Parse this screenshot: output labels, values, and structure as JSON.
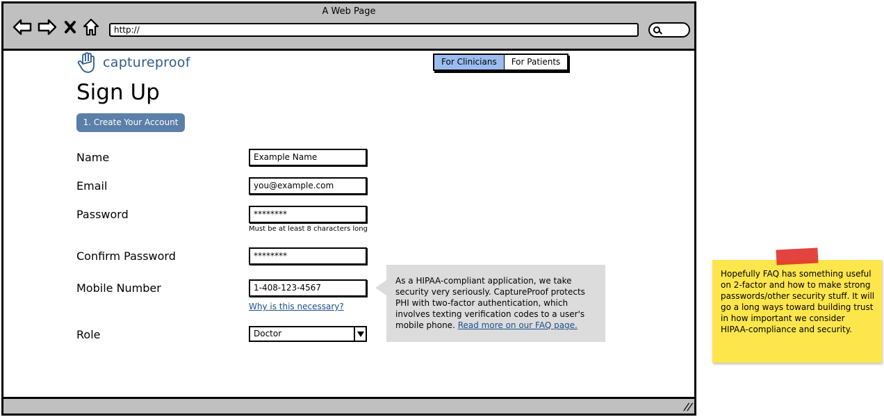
{
  "window": {
    "title": "A Web Page",
    "url": "http://",
    "nav_icons": [
      "back-arrow-icon",
      "forward-arrow-icon",
      "close-x-icon",
      "home-icon"
    ],
    "search_icon": "magnifier-icon"
  },
  "brand": {
    "logo_icon": "hand-icon",
    "name": "captureproof",
    "color": "#2d5b8e"
  },
  "audience_tabs": [
    {
      "label": "For Clinicians",
      "active": true
    },
    {
      "label": "For Patients",
      "active": false
    }
  ],
  "page": {
    "title": "Sign Up",
    "step_label": "1. Create Your Account"
  },
  "form": {
    "name": {
      "label": "Name",
      "value": "Example Name"
    },
    "email": {
      "label": "Email",
      "value": "you@example.com"
    },
    "password": {
      "label": "Password",
      "value": "********",
      "hint": "Must be at least 8 characters long"
    },
    "confirm_password": {
      "label": "Confirm Password",
      "value": "********"
    },
    "mobile": {
      "label": "Mobile Number",
      "value": "1-408-123-4567",
      "help_link": "Why is this necessary?"
    },
    "role": {
      "label": "Role",
      "selected": "Doctor"
    }
  },
  "callout": {
    "text": "As a HIPAA-compliant application, we take security very seriously. CaptureProof protects PHI with two-factor authentication, which involves texting verification codes to a user's mobile phone. ",
    "link": "Read more on our FAQ page."
  },
  "sticky_note": {
    "text": "Hopefully FAQ has something useful on 2-factor and how to make strong passwords/other security stuff. It will go a long ways toward building trust in how important we consider HIPAA-compliance and security."
  },
  "colors": {
    "active_tab": "#9bbcef",
    "step_button": "#5b7fa8",
    "callout_bg": "#dcdcdc",
    "sticky_bg": "#fde64b",
    "link": "#1b4f8a"
  }
}
